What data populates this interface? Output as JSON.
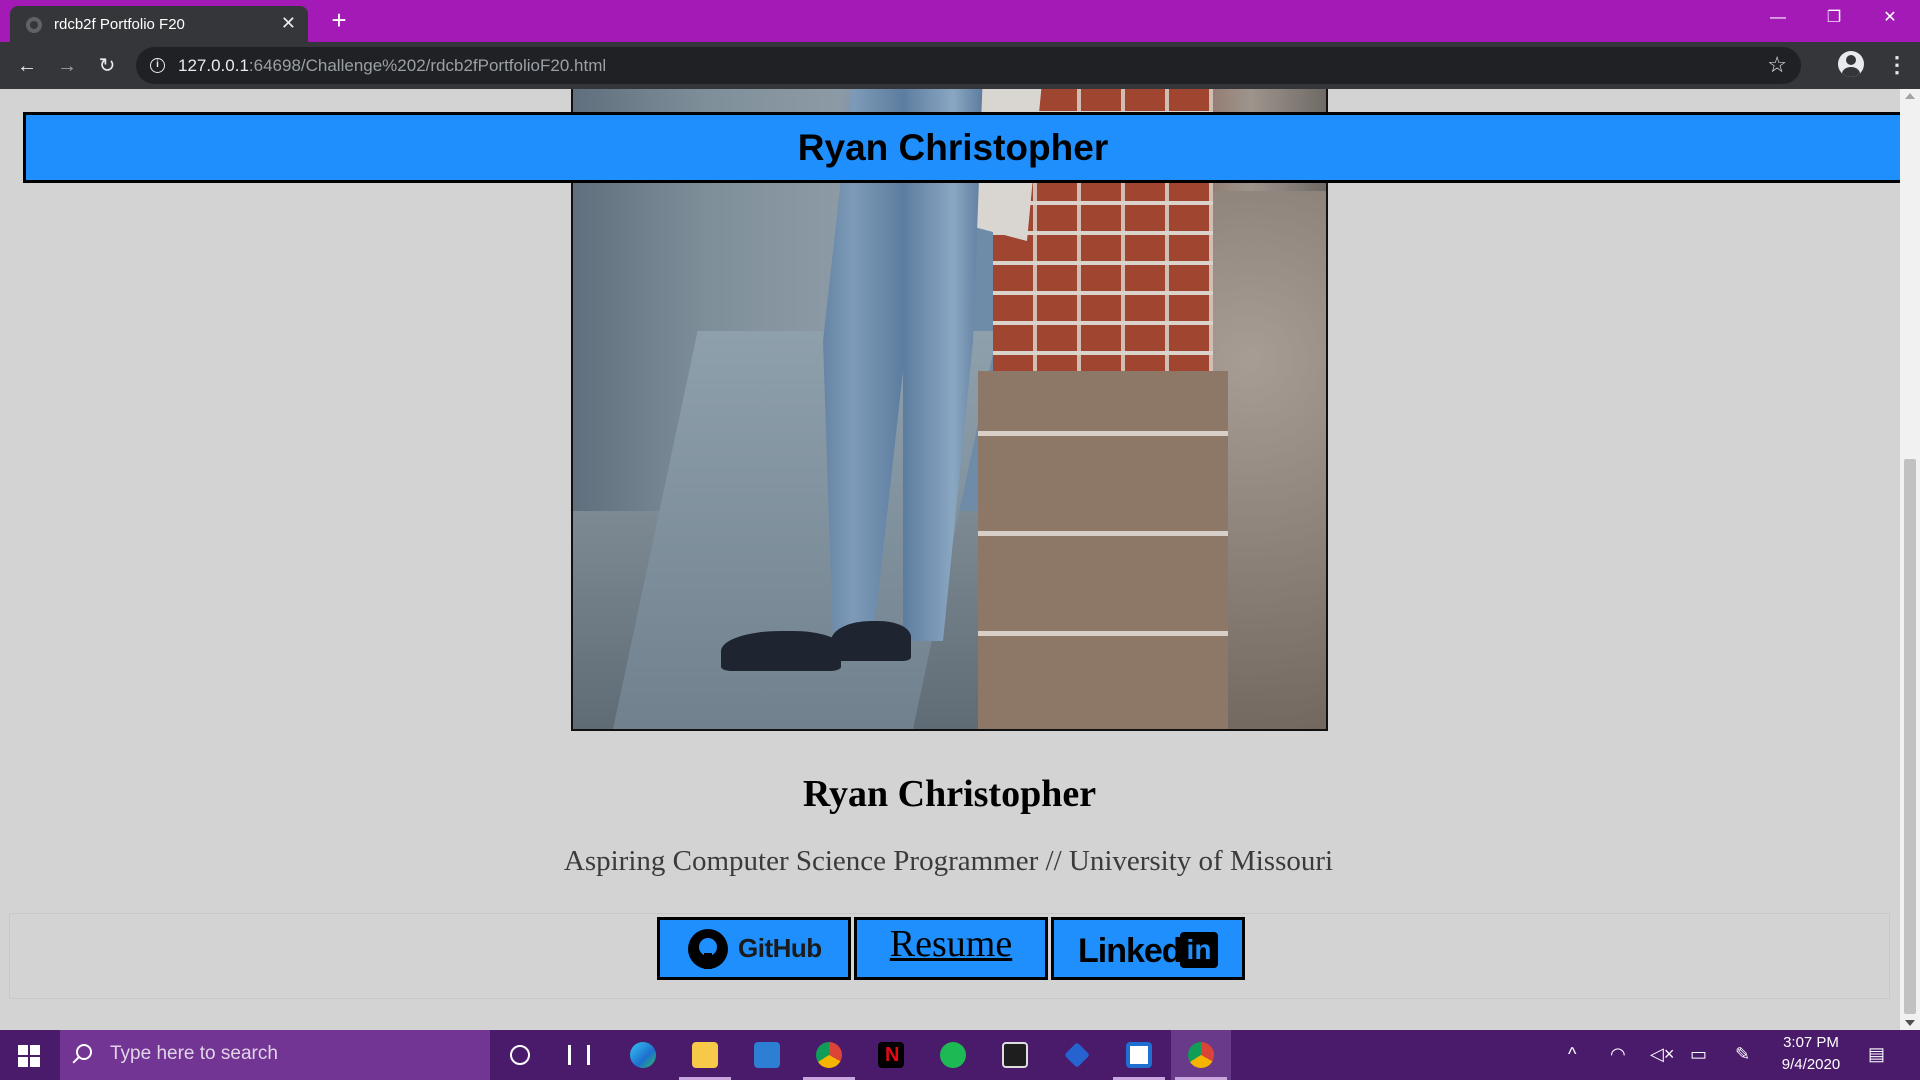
{
  "browser": {
    "tab_title": "rdcb2f Portfolio F20",
    "tab_close": "✕",
    "new_tab": "+",
    "url_host": "127.0.0.1",
    "url_rest": ":64698/Challenge%202/rdcb2fPortfolioF20.html",
    "back": "←",
    "forward": "→",
    "reload": "↻",
    "star": "☆",
    "menu": "⋮",
    "minimize": "—",
    "restore": "❐",
    "close": "✕",
    "titlebar_color": "#a31ab7"
  },
  "page": {
    "header_name": "Ryan Christopher",
    "profile_name": "Ryan Christopher",
    "tagline": "Aspiring Computer Science Programmer // University of Missouri",
    "accent_color": "#1e8ffd",
    "links": {
      "github_label": "GitHub",
      "resume_label": "Resume",
      "linkedin_label": "Linked",
      "linkedin_in": "in"
    }
  },
  "taskbar": {
    "search_placeholder": "Type here to search",
    "time": "3:07 PM",
    "date": "9/4/2020",
    "apps": [
      "edge-icon",
      "file-explorer-icon",
      "mail-icon",
      "chrome-icon",
      "netflix-icon",
      "spotify-icon",
      "terminal-icon",
      "todo-icon",
      "snip-icon",
      "chrome-icon"
    ],
    "tray_up": "^"
  }
}
